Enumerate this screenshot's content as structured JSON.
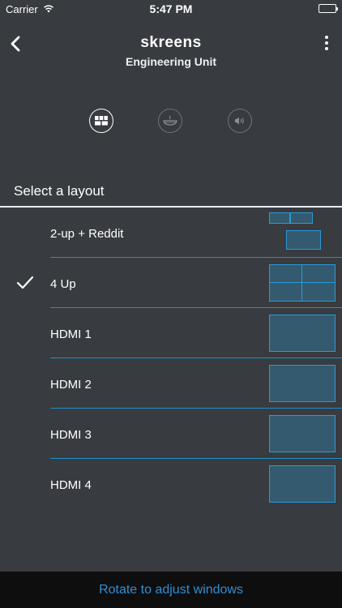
{
  "status_bar": {
    "carrier": "Carrier",
    "time": "5:47 PM",
    "battery_level": 1.0
  },
  "nav": {
    "brand": "skreens",
    "subtitle": "Engineering Unit",
    "back_icon": "chevron-left-icon",
    "more_icon": "more-vertical-icon"
  },
  "tabs": [
    {
      "name": "layout",
      "icon": "grid-icon",
      "selected": true
    },
    {
      "name": "source",
      "icon": "bowl-icon",
      "selected": false
    },
    {
      "name": "audio",
      "icon": "speaker-icon",
      "selected": false
    }
  ],
  "section": {
    "title": "Select a layout"
  },
  "layouts": [
    {
      "label": "2-up + Reddit",
      "selected": false,
      "preview": "two-small-one-sub"
    },
    {
      "label": "4 Up",
      "selected": true,
      "preview": "quad"
    },
    {
      "label": "HDMI 1",
      "selected": false,
      "preview": "single"
    },
    {
      "label": "HDMI 2",
      "selected": false,
      "preview": "single"
    },
    {
      "label": "HDMI 3",
      "selected": false,
      "preview": "single"
    },
    {
      "label": "HDMI 4",
      "selected": false,
      "preview": "single"
    }
  ],
  "bottom_bar": {
    "text": "Rotate to adjust windows"
  },
  "colors": {
    "background": "#383b40",
    "accent": "#2b9ad6",
    "bottom_text": "#2f8fd6"
  }
}
